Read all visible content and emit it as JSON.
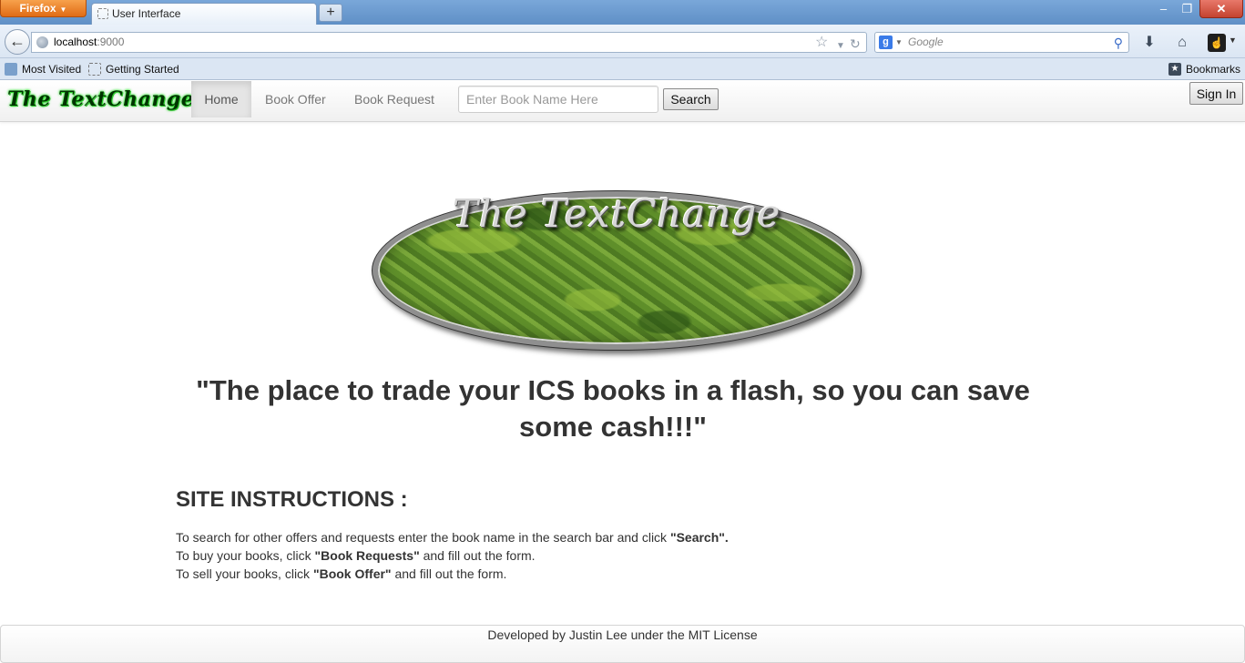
{
  "browser": {
    "app_button": "Firefox",
    "tab_title": "User Interface",
    "url_host": "localhost",
    "url_port": ":9000",
    "search_engine_placeholder": "Google",
    "bookmarks": [
      "Most Visited",
      "Getting Started"
    ],
    "bookmarks_menu": "Bookmarks"
  },
  "site": {
    "brand": "The TextChange",
    "nav": {
      "home": "Home",
      "book_offer": "Book Offer",
      "book_request": "Book Request"
    },
    "search": {
      "placeholder": "Enter Book Name Here",
      "button": "Search"
    },
    "sign_in": "Sign In",
    "logo_text": "The TextChange",
    "tagline": "\"The place to trade your ICS books in a flash, so you can save some cash!!!\"",
    "instructions": {
      "heading": "SITE INSTRUCTIONS :",
      "line1_prefix": "To search for other offers and requests enter the book name in the search bar and click ",
      "line1_bold": "\"Search\".",
      "line2_prefix": "To buy your books, click ",
      "line2_bold": "\"Book Requests\"",
      "line2_suffix": " and fill out the form.",
      "line3_prefix": "To sell your books, click ",
      "line3_bold": "\"Book Offer\"",
      "line3_suffix": " and fill out the form."
    },
    "footer": "Developed by Justin Lee under the MIT License"
  }
}
